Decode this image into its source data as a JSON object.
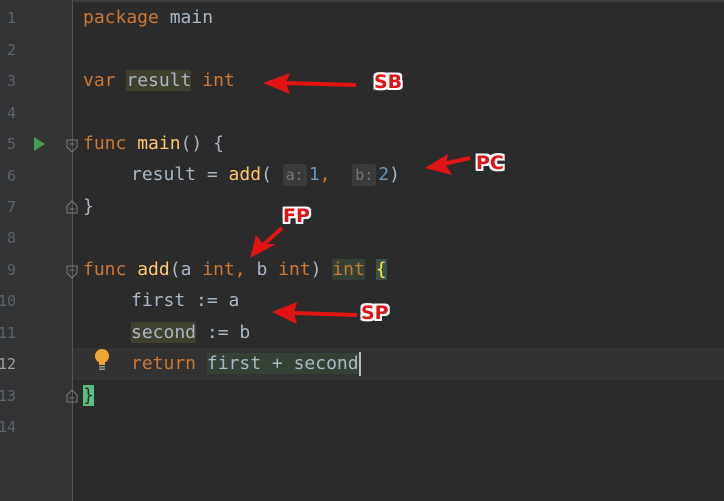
{
  "gutter": {
    "line_numbers": [
      "1",
      "2",
      "3",
      "4",
      "5",
      "6",
      "7",
      "8",
      "9",
      "10",
      "11",
      "12",
      "13",
      "14"
    ]
  },
  "code": {
    "line1": {
      "keyword": "package",
      "name": "main"
    },
    "line3": {
      "keyword": "var",
      "name": "result",
      "type": "int"
    },
    "line5": {
      "keyword": "func",
      "name": "main",
      "rest": "() {"
    },
    "line6": {
      "target": "result",
      "op": " = ",
      "call": "add",
      "open": "(",
      "hint_a": "a:",
      "arg1": "1",
      "comma": ",",
      "hint_b": "b:",
      "arg2": "2",
      "close": ")"
    },
    "line7": {
      "brace": "}"
    },
    "line9": {
      "keyword": "func",
      "name": "add",
      "open": "(",
      "param_a": "a ",
      "type_a": "int",
      "comma": ",",
      "param_b": " b ",
      "type_b": "int",
      "close": ")",
      "ret_type": "int",
      "brace": "{"
    },
    "line10": {
      "name": "first",
      "op": " := ",
      "value": "a"
    },
    "line11": {
      "name": "second",
      "op": " := ",
      "value": "b"
    },
    "line12": {
      "keyword": "return",
      "expr": "first + second"
    },
    "line13": {
      "brace": "}"
    }
  },
  "annotations": {
    "sb": "SB",
    "pc": "PC",
    "fp": "FP",
    "sp": "SP"
  },
  "colors": {
    "background": "#2b2b2b",
    "keyword": "#cc7832",
    "function": "#ffc66d",
    "number": "#6897bb",
    "text": "#a9b7c6",
    "annotation": "#e01414"
  },
  "icons": {
    "run": "run-gutter-icon",
    "fold": "fold-icon",
    "intention": "lightbulb-icon"
  }
}
